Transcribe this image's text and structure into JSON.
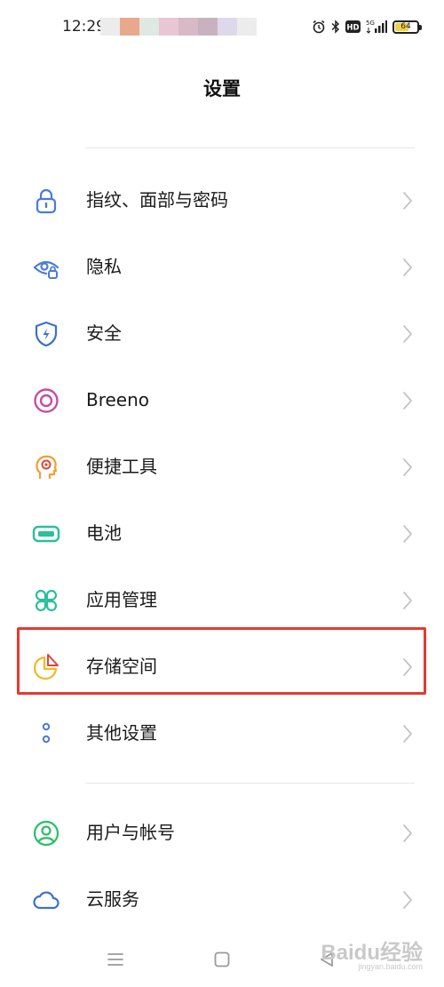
{
  "status_bar": {
    "time": "12:29",
    "battery_level": "64",
    "network": "5G",
    "hd_badge": "HD",
    "icons": [
      "alarm-icon",
      "bluetooth-icon",
      "hd-icon",
      "signal-5g-icon",
      "battery-icon"
    ]
  },
  "header": {
    "title": "设置"
  },
  "settings": {
    "items": [
      {
        "label": "指纹、面部与密码",
        "icon": "lock-icon",
        "color": "#4a7bd8"
      },
      {
        "label": "隐私",
        "icon": "privacy-eye-icon",
        "color": "#4a7bd8"
      },
      {
        "label": "安全",
        "icon": "shield-icon",
        "color": "#3b6fd6"
      },
      {
        "label": "Breeno",
        "icon": "breeno-icon",
        "color": "#c04fa8"
      },
      {
        "label": "便捷工具",
        "icon": "head-tool-icon",
        "color": "#f0a030"
      },
      {
        "label": "电池",
        "icon": "battery-icon",
        "color": "#2bbf9b"
      },
      {
        "label": "应用管理",
        "icon": "apps-grid-icon",
        "color": "#2bbf9b"
      },
      {
        "label": "存储空间",
        "icon": "pie-chart-icon",
        "color": "#f3b824"
      },
      {
        "label": "其他设置",
        "icon": "more-dots-icon",
        "color": "#4a7bd8"
      }
    ],
    "account_items": [
      {
        "label": "用户与帐号",
        "icon": "user-icon",
        "color": "#2bbf66"
      },
      {
        "label": "云服务",
        "icon": "cloud-icon",
        "color": "#3b6fd6"
      }
    ]
  },
  "highlight": {
    "target": "存储空间",
    "color": "#e53a2f"
  },
  "watermark": {
    "main": "Baidu经验",
    "sub": "jingyan.baidu.com"
  }
}
